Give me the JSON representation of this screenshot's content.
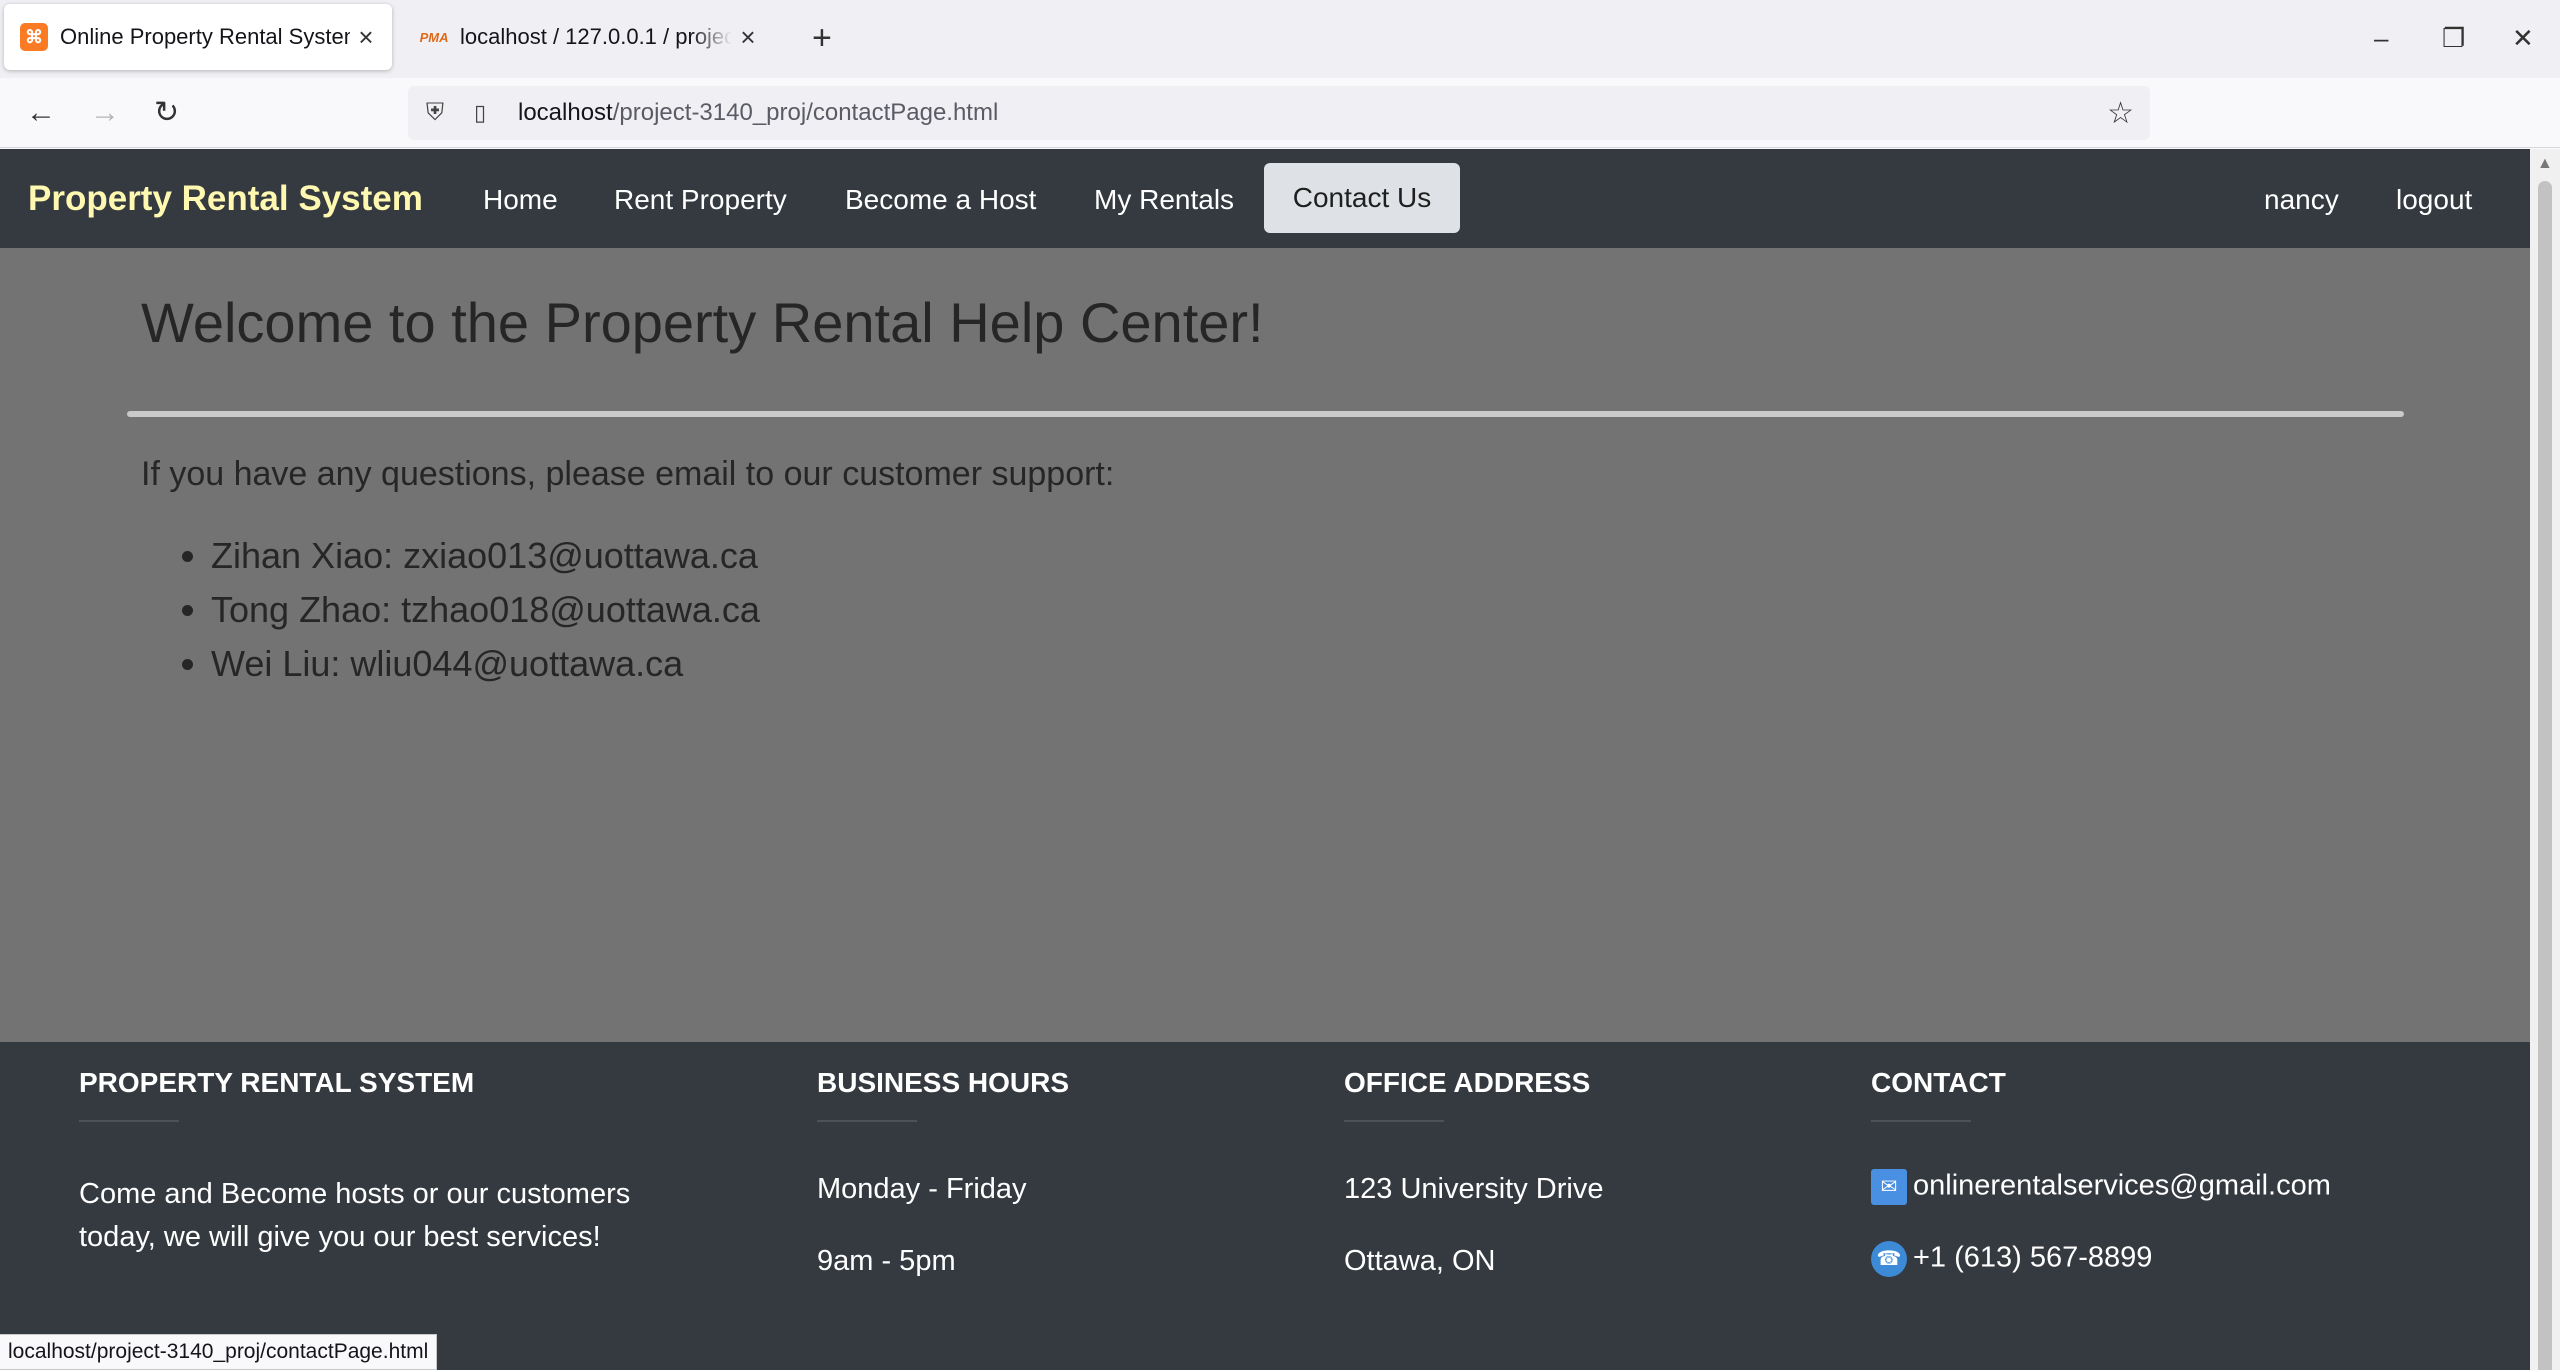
{
  "browser": {
    "tabs": [
      {
        "title": "Online Property Rental System",
        "icon": "xampp-icon"
      },
      {
        "title": "localhost / 127.0.0.1 / project-3140",
        "icon": "phpmyadmin-icon"
      }
    ],
    "url_host": "localhost",
    "url_path": "/project-3140_proj/contactPage.html",
    "status_url": "localhost/project-3140_proj/contactPage.html"
  },
  "site": {
    "brand": "Property Rental System",
    "nav": {
      "home": "Home",
      "rent": "Rent Property",
      "host": "Become a Host",
      "rentals": "My Rentals",
      "contact": "Contact Us"
    },
    "user": "nancy",
    "logout": "logout"
  },
  "main": {
    "heading": "Welcome to the Property Rental Help Center!",
    "intro": "If you have any questions, please email to our customer support:",
    "contacts": [
      "Zihan Xiao: zxiao013@uottawa.ca",
      "Tong Zhao: tzhao018@uottawa.ca",
      "Wei Liu: wliu044@uottawa.ca"
    ]
  },
  "footer": {
    "about": {
      "heading": "PROPERTY RENTAL SYSTEM",
      "text": "Come and Become hosts or our customers today, we will give you our best services!"
    },
    "hours": {
      "heading": "BUSINESS HOURS",
      "days": "Monday - Friday",
      "time": "9am - 5pm"
    },
    "address": {
      "heading": "OFFICE ADDRESS",
      "line1": "123 University Drive",
      "line2": "Ottawa, ON"
    },
    "contact": {
      "heading": "CONTACT",
      "email": "onlinerentalservices@gmail.com",
      "phone": "+1 (613) 567-8899"
    }
  },
  "colors": {
    "navbar": "#343a40",
    "brand": "#fff8b0",
    "overlay": "#737373",
    "active_nav": "#dee2e6"
  }
}
